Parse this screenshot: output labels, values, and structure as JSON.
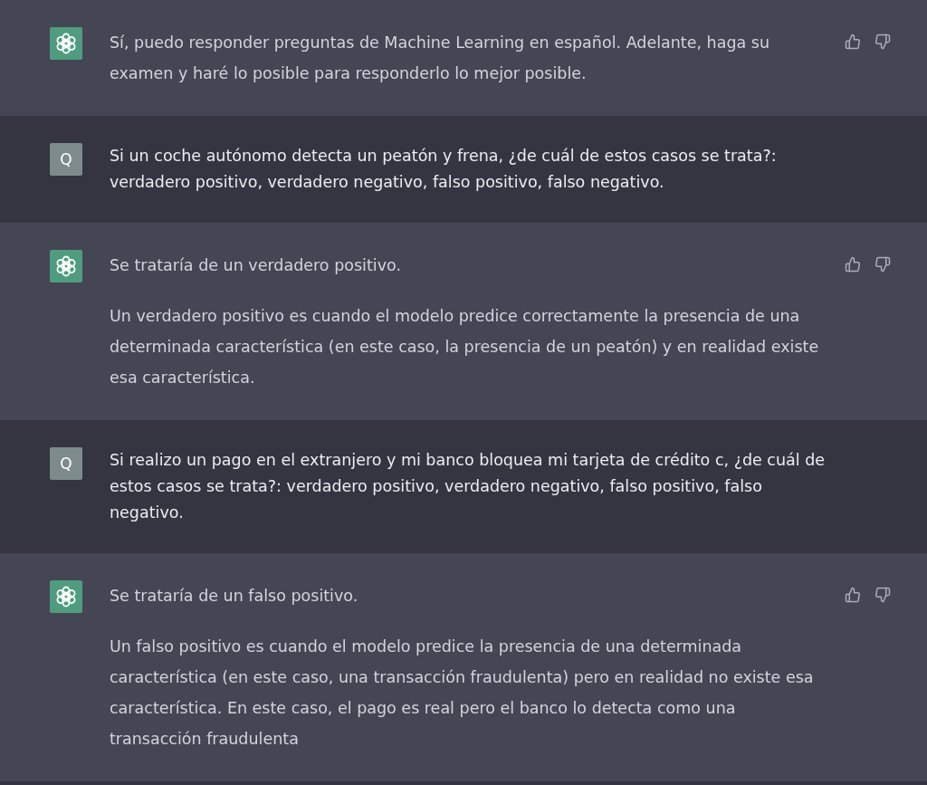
{
  "messages": [
    {
      "kind": "assistant",
      "paragraphs": [
        "Sí, puedo responder preguntas de Machine Learning en español. Adelante, haga su examen y haré lo posible para responderlo lo mejor posible."
      ]
    },
    {
      "kind": "user",
      "avatar": "Q",
      "paragraphs": [
        "Si un coche autónomo detecta un peatón y frena, ¿de cuál de estos casos se trata?: verdadero positivo, verdadero negativo, falso positivo, falso negativo."
      ]
    },
    {
      "kind": "assistant",
      "paragraphs": [
        "Se trataría de un verdadero positivo.",
        "Un verdadero positivo es cuando el modelo predice correctamente la presencia de una determinada característica (en este caso, la presencia de un peatón) y en realidad existe esa característica."
      ]
    },
    {
      "kind": "user",
      "avatar": "Q",
      "paragraphs": [
        "Si realizo un pago en el extranjero y mi banco bloquea mi tarjeta de crédito c, ¿de cuál de estos casos se trata?: verdadero positivo, verdadero negativo, falso positivo, falso negativo."
      ]
    },
    {
      "kind": "assistant",
      "paragraphs": [
        "Se trataría de un falso positivo.",
        "Un falso positivo es cuando el modelo predice la presencia de una determinada característica (en este caso, una transacción fraudulenta) pero en realidad no existe esa característica. En este caso, el pago es real pero el banco lo detecta como una transacción fraudulenta"
      ]
    }
  ]
}
